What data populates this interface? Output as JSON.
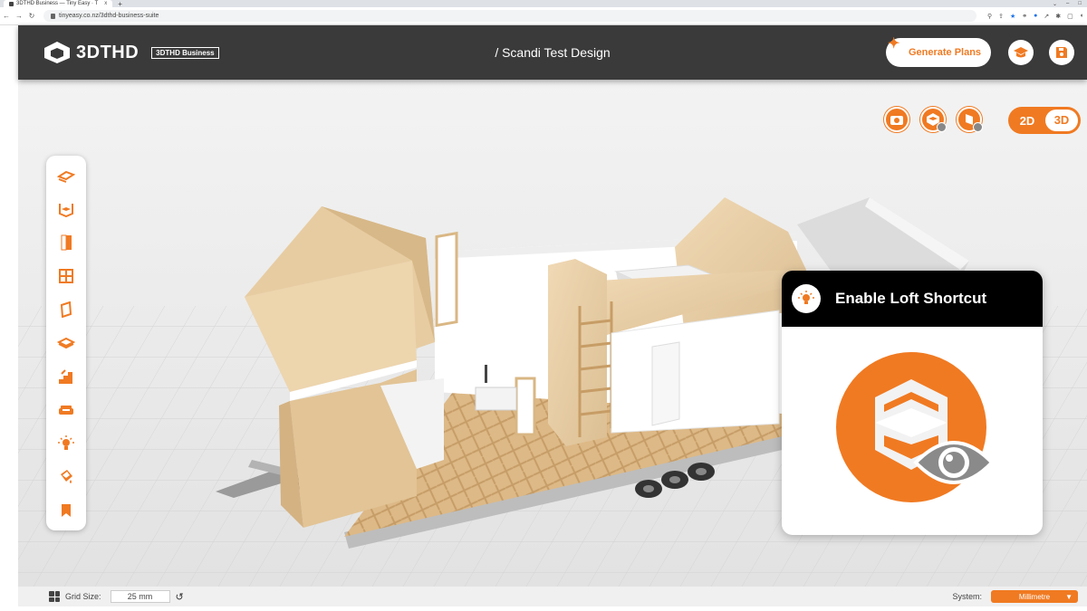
{
  "browser": {
    "tab_title": "3DTHD Business — Tiny Easy · T",
    "tab_close": "x",
    "new_tab": "+",
    "url": "tinyeasy.co.nz/3dthd-business-suite"
  },
  "header": {
    "logo_text": "3DTHD",
    "badge": "3DTHD Business",
    "design_title": "/ Scandi Test Design",
    "generate_label": "Generate Plans"
  },
  "view_toggle": {
    "two_d": "2D",
    "three_d": "3D",
    "selected": "3D"
  },
  "loft_card": {
    "title": "Enable Loft Shortcut"
  },
  "footer": {
    "grid_label": "Grid Size:",
    "grid_value": "25 mm",
    "system_label": "System:",
    "system_value": "Millimetre"
  },
  "colors": {
    "accent": "#f07a22",
    "header_bg": "#3a3a3a",
    "wood": "#e8cfa8",
    "card_header": "#000000"
  },
  "icons": {
    "toolbar": [
      "floor-icon",
      "room-icon",
      "door-icon",
      "window-icon",
      "wall-panel-icon",
      "loft-icon",
      "stairs-icon",
      "sofa-icon",
      "light-icon",
      "paint-bucket-icon",
      "bookmark-icon"
    ],
    "view_tools": [
      "camera-icon",
      "loft-view-icon",
      "wall-view-icon"
    ],
    "header": [
      "graduation-cap-icon",
      "save-icon"
    ]
  }
}
